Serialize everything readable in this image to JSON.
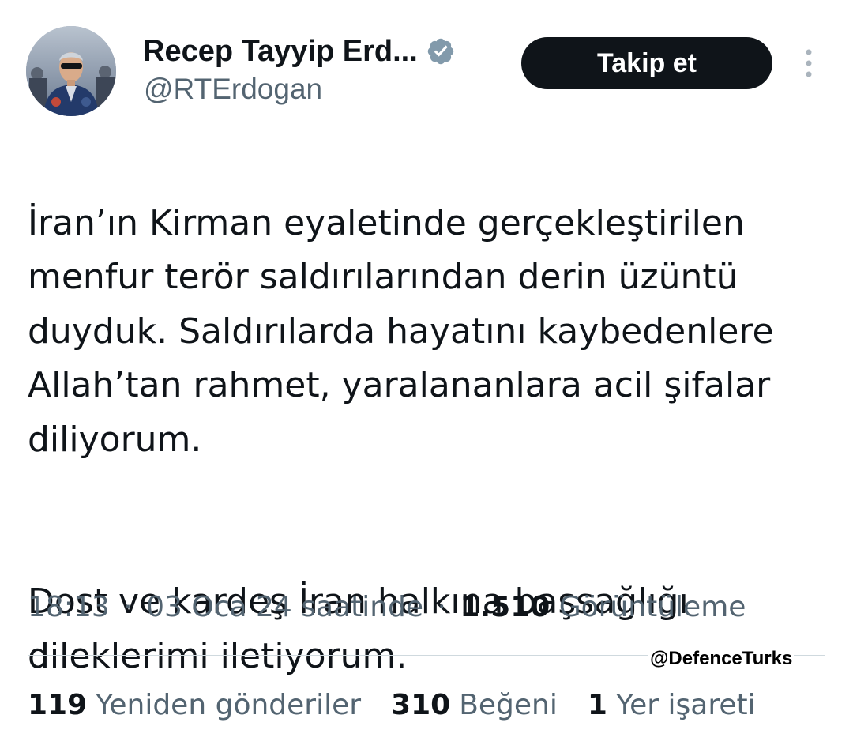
{
  "author": {
    "display_name": "Recep Tayyip Erd...",
    "handle": "@RTErdogan",
    "verified_icon": "verified-badge-icon"
  },
  "actions": {
    "follow_label": "Takip et",
    "more_icon": "more-vertical-icon"
  },
  "tweet": {
    "paragraphs": [
      "İran’ın Kirman eyaletinde gerçekleştirilen\nmenfur terör saldırılarından derin üzüntü\nduyduk. Saldırılarda hayatını kaybedenlere\nAllah’tan rahmet, yaralananlara acil şifalar\ndiliyorum.",
      "Dost ve kardeş İran halkına başsağlığı\ndileklerimi iletiyorum."
    ]
  },
  "meta": {
    "time": "18:13",
    "separator": "·",
    "date": "03 Oca 24 saatinde",
    "views_count": "1.510",
    "views_label": "Görüntüleme"
  },
  "watermark": "@DefenceTurks",
  "stats": [
    {
      "count": "119",
      "label": "Yeniden gönderiler"
    },
    {
      "count": "310",
      "label": "Beğeni"
    },
    {
      "count": "1",
      "label": "Yer işareti"
    }
  ],
  "colors": {
    "text_primary": "#0f1419",
    "text_secondary": "#536471",
    "verified": "#829aab",
    "button_bg": "#0f1419",
    "divider": "#cfd9de"
  }
}
